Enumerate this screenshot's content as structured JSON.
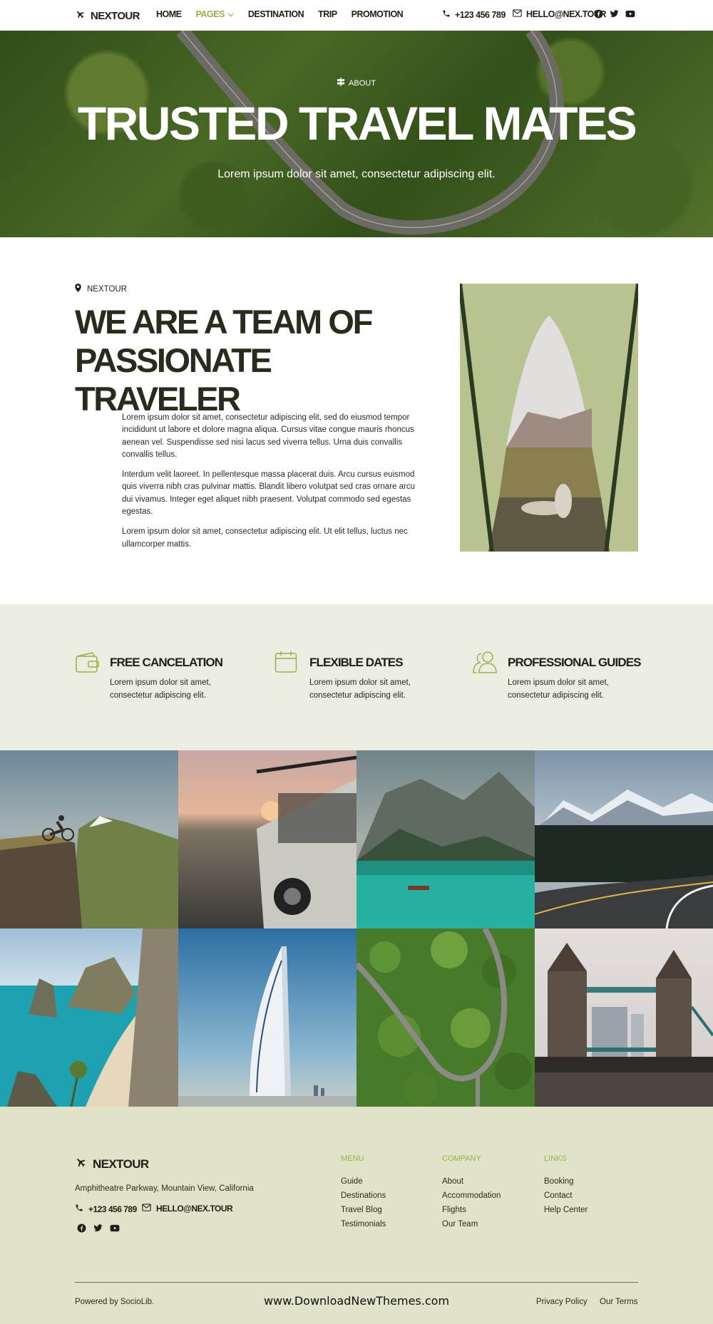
{
  "brand": {
    "name": "NEXTOUR",
    "accent": "#9bb04a",
    "dark": "#2a2a1d"
  },
  "nav": {
    "items": [
      {
        "label": "HOME"
      },
      {
        "label": "PAGES"
      },
      {
        "label": "DESTINATION"
      },
      {
        "label": "TRIP"
      },
      {
        "label": "PROMOTION"
      }
    ],
    "phone": "+123 456 789",
    "email": "HELLO@NEX.TOUR",
    "social_icons": [
      "facebook-icon",
      "twitter-icon",
      "youtube-icon"
    ]
  },
  "hero": {
    "eyebrow": "ABOUT",
    "title": "TRUSTED TRAVEL MATES",
    "subtitle": "Lorem ipsum dolor sit amet, consectetur adipiscing elit."
  },
  "about": {
    "eyebrow": "NEXTOUR",
    "title_line1": "WE ARE A TEAM OF",
    "title_line2": "PASSIONATE TRAVELER",
    "paragraphs": [
      "Lorem ipsum dolor sit amet, consectetur adipiscing elit, sed do eiusmod tempor incididunt ut labore et dolore magna aliqua. Cursus vitae congue mauris rhoncus aenean vel. Suspendisse sed nisi lacus sed viverra tellus. Urna duis convallis convallis tellus.",
      "Interdum velit laoreet. In pellentesque massa placerat duis. Arcu cursus euismod quis viverra nibh cras pulvinar mattis. Blandit libero volutpat sed cras ornare arcu dui vivamus. Integer eget aliquet nibh praesent. Volutpat commodo sed egestas egestas.",
      "Lorem ipsum dolor sit amet, consectetur adipiscing elit. Ut elit tellus, luctus nec ullamcorper mattis."
    ]
  },
  "features": [
    {
      "icon": "wallet-icon",
      "title": "FREE CANCELATION",
      "desc": "Lorem ipsum dolor sit amet, consectetur adipiscing elit."
    },
    {
      "icon": "calendar-icon",
      "title": "FLEXIBLE DATES",
      "desc": "Lorem ipsum dolor sit amet, consectetur adipiscing elit."
    },
    {
      "icon": "users-icon",
      "title": "PROFESSIONAL GUIDES",
      "desc": "Lorem ipsum dolor sit amet, consectetur adipiscing elit."
    }
  ],
  "footer": {
    "brand": "NEXTOUR",
    "address": "Amphitheatre Parkway, Mountain View, California",
    "phone": "+123 456 789",
    "email": "HELLO@NEX.TOUR",
    "columns": [
      {
        "heading": "MENU",
        "links": [
          "Guide",
          "Destinations",
          "Travel Blog",
          "Testimonials"
        ]
      },
      {
        "heading": "COMPANY",
        "links": [
          "About",
          "Accommodation",
          "Flights",
          "Our Team"
        ]
      },
      {
        "heading": "LINKS",
        "links": [
          "Booking",
          "Contact",
          "Help Center"
        ]
      }
    ],
    "powered": "Powered by SocioLib.",
    "watermark": "www.DownloadNewThemes.com",
    "privacy": "Privacy Policy",
    "terms": "Our Terms"
  }
}
